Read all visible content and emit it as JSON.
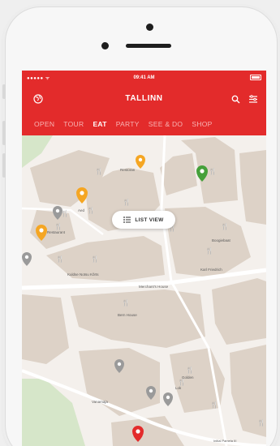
{
  "statusbar": {
    "carrier": "●●●●● ᯤ",
    "time": "09:41 AM"
  },
  "header": {
    "title": "TALLINN"
  },
  "tabs": [
    {
      "label": "OPEN",
      "active": false
    },
    {
      "label": "TOUR",
      "active": false
    },
    {
      "label": "EAT",
      "active": true
    },
    {
      "label": "PARTY",
      "active": false
    },
    {
      "label": "SEE & DO",
      "active": false
    },
    {
      "label": "SHOP",
      "active": false
    }
  ],
  "map": {
    "list_view_label": "LIST VIEW",
    "labels": {
      "restoran_top": "Restoran",
      "rataskaevu": "Rataskaevu",
      "aed": "Aed",
      "restaurant": "Restaurant",
      "boogiebaat": "Boogiebaat",
      "kuldse_notsu": "Kuldse Notsu Kõrts",
      "karl_friedrich": "Karl Friedrich",
      "merchant_house": "Merchant's House",
      "bern_house": "Bern House",
      "golden": "Golden",
      "lok": "Lok",
      "vanamaja": "Vanamaja",
      "attribution": "Initial Pamela III"
    },
    "colors": {
      "pin_orange": "#f5a623",
      "pin_green": "#45a03a",
      "pin_gray": "#9a9a9a",
      "pin_red": "#e32b2b",
      "building": "#ddd2c7",
      "street": "#f6f2ee",
      "park": "#cfe3c2"
    }
  }
}
